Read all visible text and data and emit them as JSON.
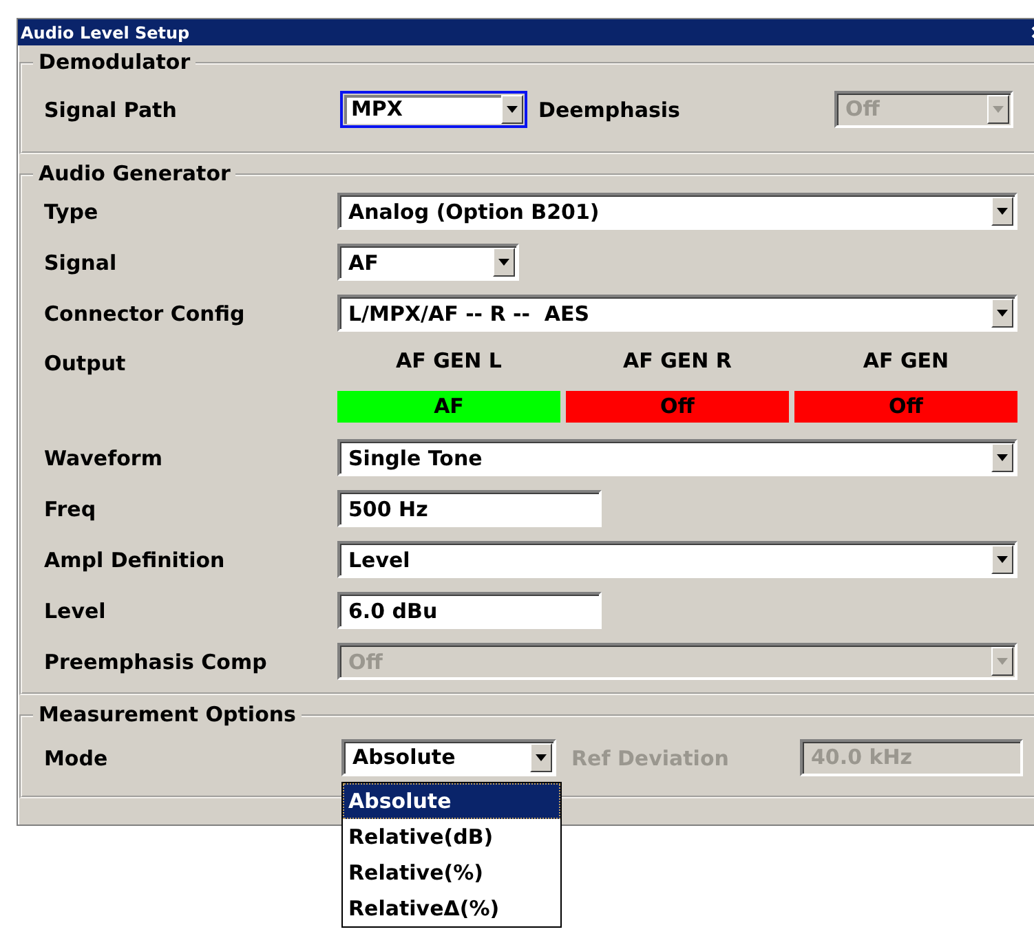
{
  "window": {
    "title": "Audio Level Setup"
  },
  "demodulator": {
    "title": "Demodulator",
    "signal_path": {
      "label": "Signal Path",
      "value": "MPX",
      "focused": true,
      "disabled": false
    },
    "deemphasis": {
      "label": "Deemphasis",
      "value": "Off",
      "disabled": true
    }
  },
  "audio_generator": {
    "title": "Audio Generator",
    "rows": [
      {
        "kind": "wide-select",
        "label": "Type",
        "value": "Analog (Option B201)",
        "disabled": false
      },
      {
        "kind": "short-select",
        "label": "Signal",
        "value": "AF",
        "disabled": false
      },
      {
        "kind": "wide-select",
        "label": "Connector Config",
        "value": "L/MPX/AF -- R --  AES",
        "disabled": false
      },
      {
        "kind": "output",
        "label": "Output",
        "channels": [
          {
            "name": "AF GEN L",
            "state": "AF",
            "active": true
          },
          {
            "name": "AF GEN R",
            "state": "Off",
            "active": false
          },
          {
            "name": "AF GEN",
            "state": "Off",
            "active": false
          }
        ]
      },
      {
        "kind": "wide-select",
        "label": "Waveform",
        "value": "Single Tone",
        "disabled": false
      },
      {
        "kind": "text-field",
        "label": "Freq",
        "value": "500 Hz",
        "disabled": false
      },
      {
        "kind": "wide-select",
        "label": "Ampl Definition",
        "value": "Level",
        "disabled": false
      },
      {
        "kind": "text-field",
        "label": "Level",
        "value": "6.0 dBu",
        "disabled": false
      },
      {
        "kind": "wide-select",
        "label": "Preemphasis Comp",
        "value": "Off",
        "disabled": true
      }
    ]
  },
  "measurement_options": {
    "title": "Measurement Options",
    "mode": {
      "label": "Mode",
      "value": "Absolute",
      "expanded": true,
      "options": [
        {
          "label": "Absolute",
          "selected": true
        },
        {
          "label": "Relative(dB)",
          "selected": false
        },
        {
          "label": "Relative(%)",
          "selected": false
        },
        {
          "label": "RelativeΔ(%)",
          "selected": false
        }
      ]
    },
    "ref_deviation": {
      "label": "Ref Deviation",
      "value": "40.0 kHz",
      "disabled": true
    }
  }
}
